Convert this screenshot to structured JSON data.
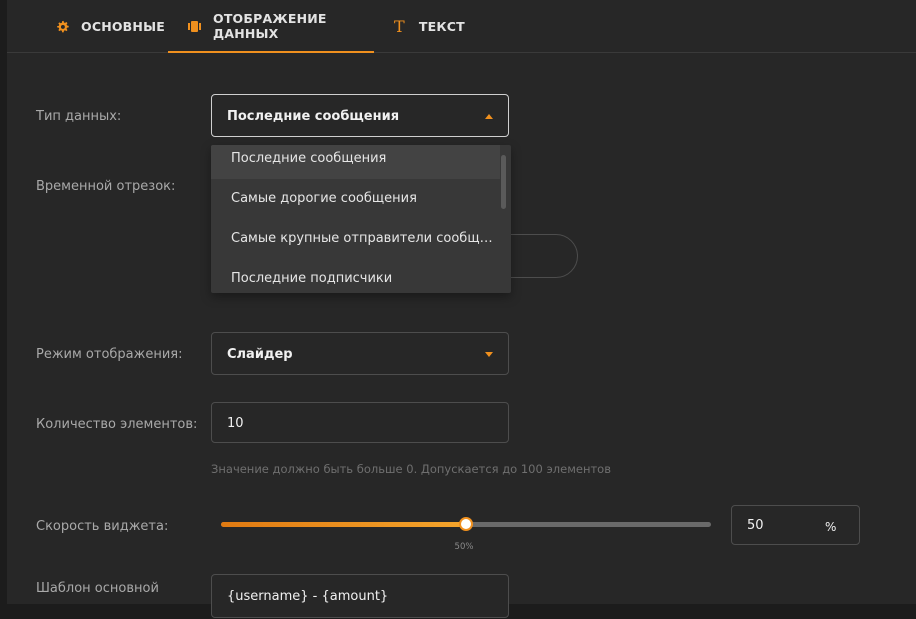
{
  "tabs": [
    {
      "label": "ОСНОВНЫЕ",
      "icon": "gear-icon"
    },
    {
      "label": "ОТОБРАЖЕНИЕ ДАННЫХ",
      "icon": "display-icon",
      "active": true
    },
    {
      "label": "ТЕКСТ",
      "icon": "text-icon"
    }
  ],
  "accent_color": "#f0901e",
  "fields": {
    "data_type": {
      "label": "Тип данных:",
      "value": "Последние сообщения"
    },
    "time_range": {
      "label": "Временной отрезок:"
    },
    "display_mode": {
      "label": "Режим отображения:",
      "value": "Слайдер"
    },
    "item_count": {
      "label": "Количество элементов:",
      "value": "10",
      "hint": "Значение должно быть больше 0. Допускается до 100 элементов"
    },
    "widget_speed": {
      "label": "Скорость виджета:",
      "value": "50",
      "unit": "%",
      "slider_label": "50%",
      "percent": 50
    },
    "main_template": {
      "label": "Шаблон основной",
      "value": "{username} - {amount}"
    }
  },
  "dropdown": {
    "options": [
      "Последние сообщения",
      "Самые дорогие сообщения",
      "Самые крупные отправители сообщений",
      "Последние подписчики"
    ]
  }
}
